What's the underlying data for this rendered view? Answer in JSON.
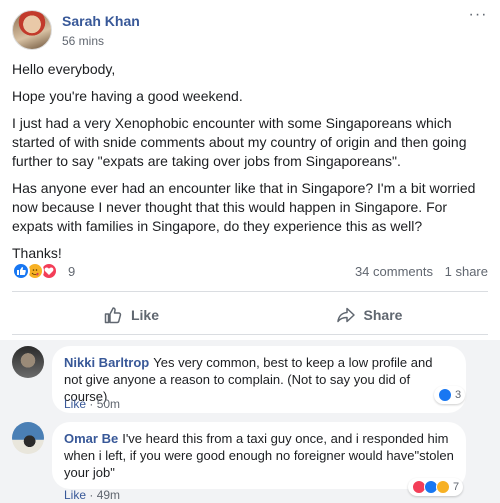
{
  "post": {
    "author": "Sarah Khan",
    "time": "56 mins",
    "paragraphs": [
      "Hello everybody,",
      "Hope you're having a good weekend.",
      "I just had a very Xenophobic encounter with some Singaporeans which started of with snide comments about my country of origin and then going further to say \"expats are taking over jobs from Singaporeans\".",
      "Has anyone ever had an encounter like that in Singapore? I'm a bit worried now because I never thought that this would happen in Singapore. For expats with families in Singapore, do they experience this as well?",
      "Thanks!"
    ],
    "reaction_icons": [
      "like-icon",
      "care-icon",
      "love-icon"
    ],
    "reaction_count": "9",
    "comments_count": "34 comments",
    "shares_count": "1 share",
    "more_label": "···"
  },
  "actions": {
    "like_label": "Like",
    "share_label": "Share"
  },
  "comments": [
    {
      "name": "Nikki Barltrop",
      "text": "Yes very common, best to keep a low profile and not give anyone a reason to complain. (Not to say you did of course)",
      "like_label": "Like",
      "time": "50m",
      "reaction_count": "3",
      "reaction_icons": [
        "like-icon"
      ]
    },
    {
      "name": "Omar Be",
      "text": "I've heard this from a taxi guy once, and i responded him when i left, if you were good enough no foreigner would have\"stolen your job\"",
      "like_label": "Like",
      "time": "49m",
      "reaction_count": "7",
      "reaction_icons": [
        "love-icon",
        "like-icon",
        "haha-icon"
      ]
    }
  ],
  "colors": {
    "link": "#385898",
    "like": "#1877f2",
    "love": "#f33e58",
    "care": "#f7b125",
    "haha": "#f7b125"
  }
}
